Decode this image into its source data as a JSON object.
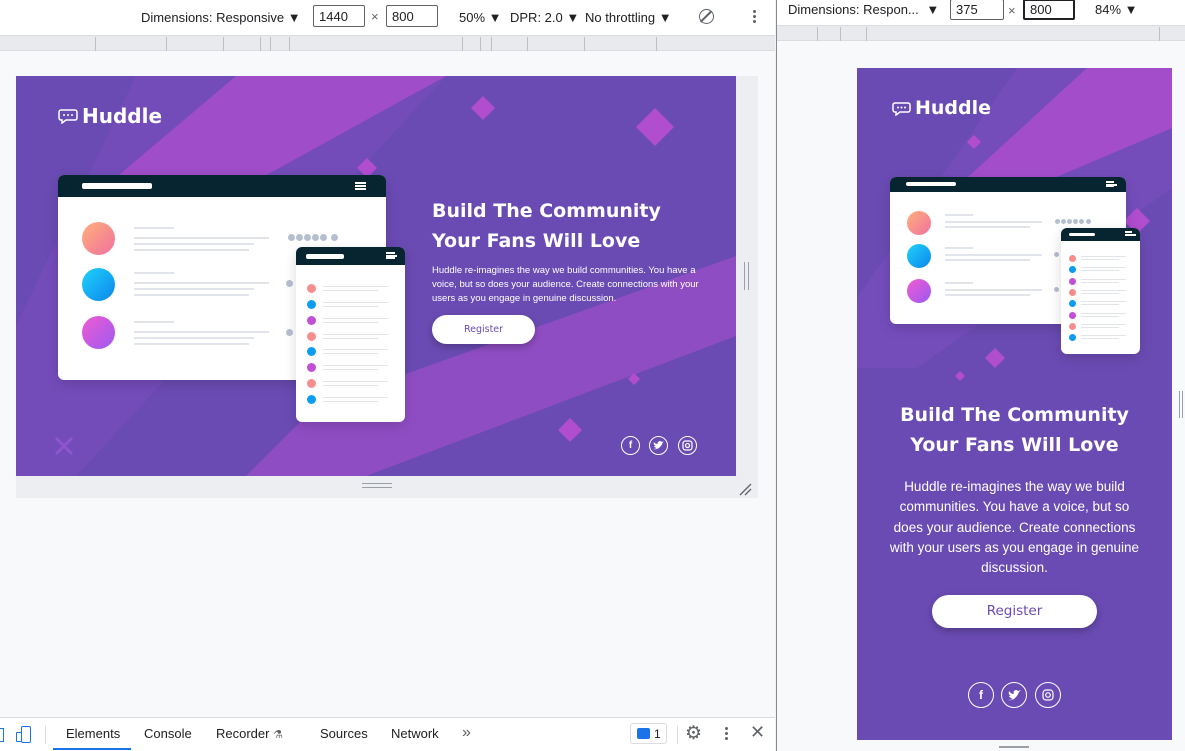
{
  "left_toolbar": {
    "dimensions_label": "Dimensions: Responsive",
    "width": "1440",
    "height": "800",
    "times": "×",
    "zoom": "50%",
    "dpr": "DPR: 2.0",
    "throttling": "No throttling"
  },
  "right_toolbar": {
    "dimensions_label": "Dimensions: Respon...",
    "width": "375",
    "height": "800",
    "times": "×",
    "zoom": "84%"
  },
  "huddle_desktop": {
    "logo": "Huddle",
    "title_line1": "Build The Community",
    "title_line2": "Your Fans Will Love",
    "description": "Huddle re-imagines the way we build communities. You have a voice, but so does your audience. Create connections with your users as you engage in genuine discussion.",
    "register": "Register"
  },
  "huddle_mobile": {
    "logo": "Huddle",
    "title_line1": "Build The Community",
    "title_line2": "Your Fans Will Love",
    "description": "Huddle re-imagines the way we build communities. You have a voice, but so does your audience. Create connections with your users as you engage in genuine discussion.",
    "register": "Register"
  },
  "social_icons": [
    "facebook-icon",
    "twitter-icon",
    "instagram-icon"
  ],
  "devtools_tabs": {
    "elements": "Elements",
    "console": "Console",
    "recorder": "Recorder",
    "sources": "Sources",
    "network": "Network",
    "more": "»",
    "issues_count": "1"
  },
  "colors": {
    "brand_violet": "#6a4bb3",
    "magenta": "#c34ed6",
    "dark_bar": "#062530",
    "devtools_blue": "#1a73e8"
  }
}
